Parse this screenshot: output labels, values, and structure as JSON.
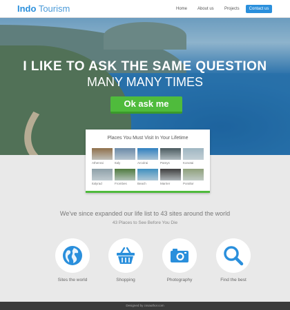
{
  "nav": {
    "brand_bold": "Indo",
    "brand_rest": "Tourism",
    "links": [
      "Home",
      "About us",
      "Projects"
    ],
    "contact_label": "Contact us"
  },
  "hero": {
    "heading": "I LIKE TO ASK THE SAME QUESTION",
    "subheading": "MANY MANY TIMES",
    "cta_label": "Ok ask me"
  },
  "places": {
    "title": "Places You Must Visit In Your Lifetime",
    "items": [
      {
        "label": "Athenrai",
        "color": "#8f6f4a"
      },
      {
        "label": "Italy",
        "color": "#6a8aa8"
      },
      {
        "label": "Arcolrai",
        "color": "#2f7fbf"
      },
      {
        "label": "Pamys",
        "color": "#4a5a5f"
      },
      {
        "label": "Konotai",
        "color": "#9fb6c2"
      },
      {
        "label": "Italyrad",
        "color": "#8ea0a8"
      },
      {
        "label": "Frombes",
        "color": "#4f7a3f"
      },
      {
        "label": "Beach",
        "color": "#3f8fbf"
      },
      {
        "label": "Marrier",
        "color": "#3f3f3f"
      },
      {
        "label": "Poraltor",
        "color": "#8fa07a"
      }
    ]
  },
  "tagline": {
    "main": "We've since expanded our life list to 43 sites around the world",
    "sub": "43 Places to See Before You Die"
  },
  "features": [
    {
      "label": "Sites the world",
      "icon": "globe-icon"
    },
    {
      "label": "Shopping",
      "icon": "basket-icon"
    },
    {
      "label": "Photography",
      "icon": "camera-icon"
    },
    {
      "label": "Find the best",
      "icon": "search-icon"
    }
  ],
  "accent_color": "#2a8fdc",
  "cta_color": "#4fbb3c",
  "footer": {
    "text": "Designed by cssauthor.com"
  }
}
